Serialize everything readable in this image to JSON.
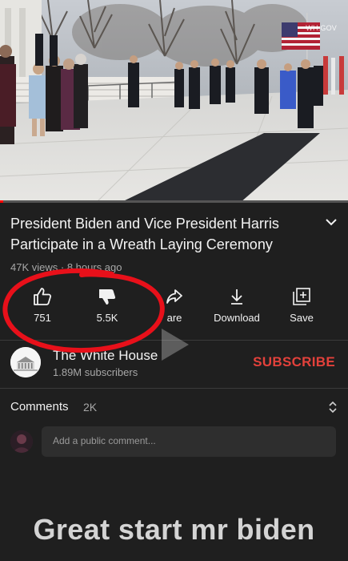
{
  "video": {
    "watermark": "WH.GOV",
    "progress_fraction": 0.01
  },
  "title": "President Biden and Vice President Harris Participate in a Wreath Laying Ceremony",
  "meta": {
    "views": "47K views",
    "separator": " · ",
    "age": "8 hours ago"
  },
  "actions": {
    "like_count": "751",
    "dislike_count": "5.5K",
    "share_label": "are",
    "download_label": "Download",
    "save_label": "Save"
  },
  "channel": {
    "name": "The White House",
    "subscribers": "1.89M subscribers",
    "subscribe_label": "SUBSCRIBE"
  },
  "comments": {
    "label": "Comments",
    "count": "2K",
    "placeholder": "Add a public comment..."
  },
  "caption": "Great start mr biden",
  "colors": {
    "background": "#1f1f1f",
    "subscribe": "#e3413b",
    "annotation_circle": "#e8101a",
    "progress": "#ff0000"
  },
  "icons": [
    "thumbs-up-icon",
    "thumbs-down-icon",
    "share-icon",
    "download-icon",
    "save-icon",
    "chevron-down-icon",
    "expand-icon"
  ]
}
